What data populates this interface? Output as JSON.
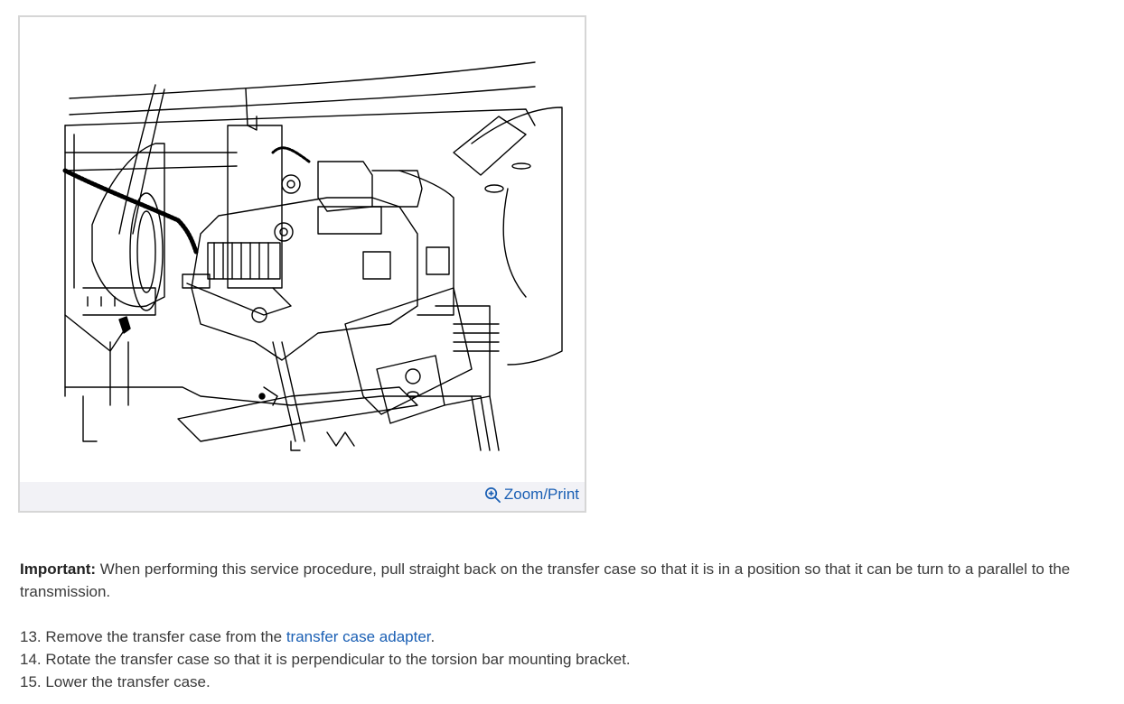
{
  "figure": {
    "zoom_label": "Zoom/Print",
    "icon": "zoom-in-icon"
  },
  "note": {
    "label": "Important:",
    "text": " When performing this service procedure, pull straight back on the transfer case so that it is in a position so that it can be turn to a parallel to the transmission."
  },
  "steps": [
    {
      "prefix": "13. Remove the transfer case from the ",
      "link": "transfer case adapter",
      "suffix": "."
    },
    {
      "prefix": "14. Rotate the transfer case so that it is perpendicular to the torsion bar mounting bracket."
    },
    {
      "prefix": "15. Lower the transfer case."
    }
  ],
  "colors": {
    "link": "#1a5fb4",
    "footer_bg": "#f2f2f6",
    "border": "#d6d6d6"
  }
}
